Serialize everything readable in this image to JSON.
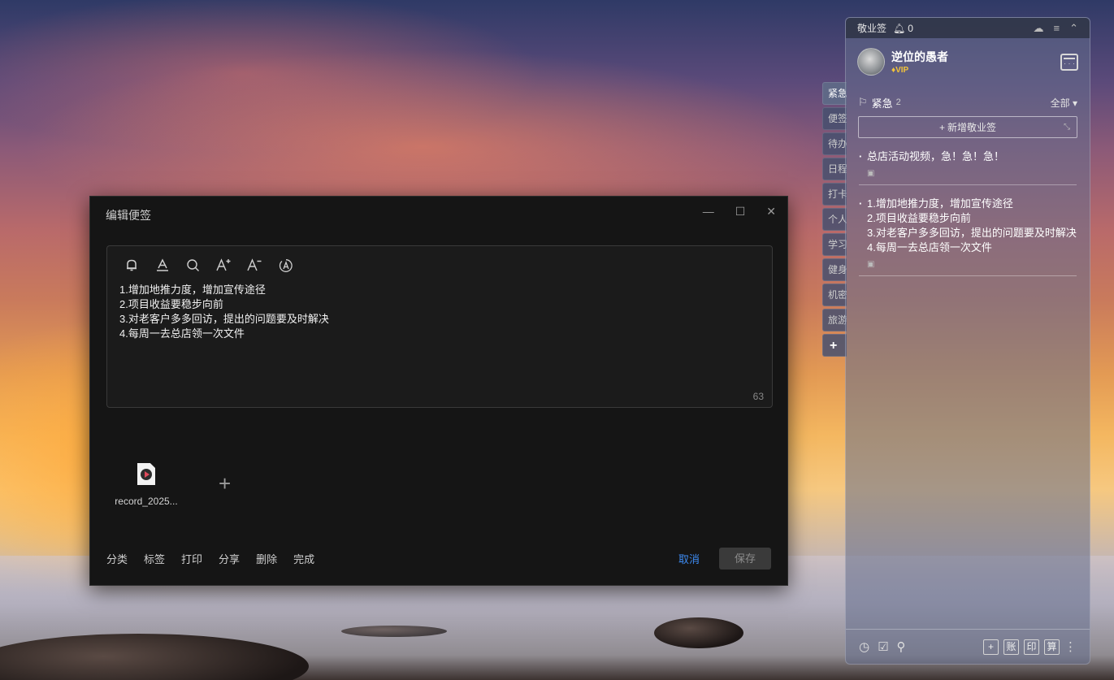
{
  "widget": {
    "app_title": "敬业签",
    "notification_count": "0",
    "user": {
      "name": "逆位的愚者",
      "badge": "VIP"
    },
    "section": {
      "title": "紧急",
      "count": "2",
      "filter": "全部"
    },
    "new_button": "新增敬业签",
    "notes": [
      {
        "text": "总店活动视频，急！急！急！"
      },
      {
        "text": "1.增加地推力度，增加宣传途径\n2.项目收益要稳步向前\n3.对老客户多多回访，提出的问题要及时解决\n4.每周一去总店领一次文件"
      }
    ],
    "bottom_tools": [
      "账",
      "印",
      "算"
    ]
  },
  "side_tabs": [
    "紧急",
    "便签",
    "待办",
    "日程",
    "打卡",
    "个人",
    "学习",
    "健身",
    "机密",
    "旅游"
  ],
  "dialog": {
    "title": "编辑便签",
    "content": "1.增加地推力度，增加宣传途径\n2.项目收益要稳步向前\n3.对老客户多多回访，提出的问题要及时解决\n4.每周一去总店领一次文件",
    "char_count": "63",
    "attachment_name": "record_2025...",
    "footer_links": [
      "分类",
      "标签",
      "打印",
      "分享",
      "删除",
      "完成"
    ],
    "cancel": "取消",
    "save": "保存"
  },
  "colors": {
    "accent": "#3d8bf2",
    "vip": "#f3c43a",
    "dialog_bg": "#151515"
  }
}
